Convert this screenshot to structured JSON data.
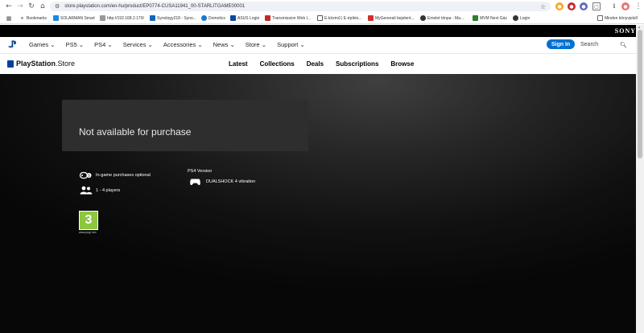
{
  "browser": {
    "url": "store.playstation.com/en-hu/product/EP0774-CUSA11941_00-STARLITGAME00001",
    "bookmarks": [
      {
        "label": "Bookmarks",
        "color": "#666666"
      },
      {
        "label": "SOLARMAN Smart",
        "color": "#1e88e5"
      },
      {
        "label": "http://192.168.2.170/",
        "color": "#555555"
      },
      {
        "label": "Synology218 - Syno...",
        "color": "#1565c0"
      },
      {
        "label": "Domotics",
        "color": "#1976d2"
      },
      {
        "label": "ASUS Login",
        "color": "#0d47a1"
      },
      {
        "label": "Transmission Web I...",
        "color": "#c62828"
      },
      {
        "label": "E-közmű | E-építés...",
        "color": "#444444"
      },
      {
        "label": "MyGenerali bejelent...",
        "color": "#d32f2f"
      },
      {
        "label": "Emelet tönpa - Ma...",
        "color": "#333333"
      },
      {
        "label": "MVM Next Gáz",
        "color": "#2e7d32"
      },
      {
        "label": "Login",
        "color": "#333333"
      }
    ],
    "other_bookmarks": "Minden könyvjelző"
  },
  "sony": {
    "logo": "SONY"
  },
  "ps_nav": {
    "items": [
      "Games",
      "PS5",
      "PS4",
      "Services",
      "Accessories",
      "News",
      "Store",
      "Support"
    ],
    "sign_in": "Sign In",
    "search_placeholder": "Search"
  },
  "store": {
    "brand_a": "PlayStation",
    "brand_b": ".Store",
    "links": [
      "Latest",
      "Collections",
      "Deals",
      "Subscriptions",
      "Browse"
    ]
  },
  "product": {
    "availability": "Not available for purchase",
    "features": {
      "purchases": "In-game purchases optional",
      "players": "1 - 4 players"
    },
    "ps4_version": "PS4 Version",
    "ps4_features": [
      "DUALSHOCK 4 vibration"
    ],
    "rating": {
      "value": "3",
      "site": "www.pegi.info",
      "color": "#8dc63f"
    }
  }
}
